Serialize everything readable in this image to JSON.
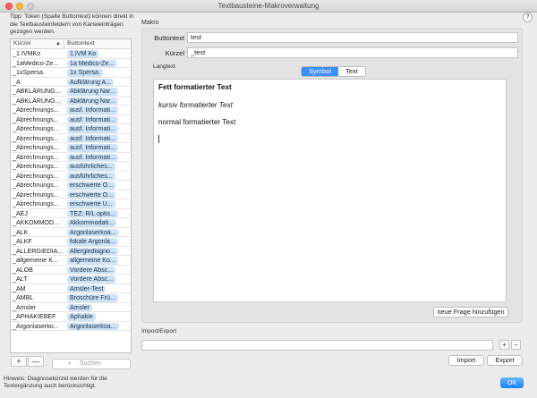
{
  "window": {
    "title": "Textbausteine-Makroverwaltung"
  },
  "tip": "Tipp: Token (Spalte Buttontext) können direkt in die Textbausteinfeldern von Karteieinträgen gezogen werden.",
  "list": {
    "col_kuerzel": "Kürzel",
    "col_buttontext": "Buttontext",
    "sort_indicator": "▲",
    "rows": [
      {
        "k": "_1.IVMKo",
        "b": "1.IVM Ko"
      },
      {
        "k": "_1aMedico-Ze...",
        "b": "1a Medico-Ze..."
      },
      {
        "k": "_1xSpersa.",
        "b": "1x Spersa."
      },
      {
        "k": "_A",
        "b": "Aufklärung A..."
      },
      {
        "k": "_ABKLÄRUNG...",
        "b": "Abklärung Nar..."
      },
      {
        "k": "_ABKLÄRUNG...",
        "b": "Abklärung Nar..."
      },
      {
        "k": "_Abrechnungs...",
        "b": "ausf. Informati..."
      },
      {
        "k": "_Abrechnungs...",
        "b": "ausf. Informati..."
      },
      {
        "k": "_Abrechnungs...",
        "b": "ausf. Informati..."
      },
      {
        "k": "_Abrechnungs...",
        "b": "ausf. Informati..."
      },
      {
        "k": "_Abrechnungs...",
        "b": "ausf. Informati..."
      },
      {
        "k": "_Abrechnungs...",
        "b": "ausf. Informati..."
      },
      {
        "k": "_Abrechnungs...",
        "b": "ausführliches..."
      },
      {
        "k": "_Abrechnungs...",
        "b": "ausführliches..."
      },
      {
        "k": "_Abrechnungs...",
        "b": "erschwerte O..."
      },
      {
        "k": "_Abrechnungs...",
        "b": "erschwerte O..."
      },
      {
        "k": "_Abrechnungs...",
        "b": "erschwerte U..."
      },
      {
        "k": "_AEJ",
        "b": "TEZ: R/L optis..."
      },
      {
        "k": "_AKKOMMOD...",
        "b": "Akkommodati..."
      },
      {
        "k": "_ALK",
        "b": "Argonlaserkoa..."
      },
      {
        "k": "_ALKF",
        "b": "fokale Argonla..."
      },
      {
        "k": "_ALLERGIEDIA...",
        "b": "Allergiediagno..."
      },
      {
        "k": "_allgemeine K...",
        "b": "allgemeine Ko..."
      },
      {
        "k": "_ALOB",
        "b": "Vordere Absc..."
      },
      {
        "k": "_ALT",
        "b": "Vordere Absc..."
      },
      {
        "k": "_AM",
        "b": "Amsler-Test"
      },
      {
        "k": "_AMBL",
        "b": "Broschüre Frü..."
      },
      {
        "k": "_Amsler",
        "b": "Amsler"
      },
      {
        "k": "_APHAKIEBEF",
        "b": "Aphakie"
      },
      {
        "k": "_Argonlaserko...",
        "b": "Argonlaserkoa..."
      }
    ]
  },
  "list_buttons": {
    "add": "+",
    "remove": "—"
  },
  "search": {
    "placeholder": "Suchen",
    "icon": "search-icon"
  },
  "hint": "Hinweis: Diagnosekürzel werden für die Textergänzung auch berücksichtigt.",
  "ok_label": "OK",
  "help_label": "?",
  "makro": {
    "section": "Makro",
    "buttontext_label": "Buttontext",
    "buttontext_value": "test",
    "kuerzel_label": "Kürzel",
    "kuerzel_value": "_test",
    "langtext_label": "Langtext",
    "tabs": [
      "Symbol",
      "Text"
    ],
    "active_tab": "Symbol",
    "editor": {
      "line_bold": "Fett formatierter Text",
      "line_italic": "kursiv formatierter Text",
      "line_normal": "normal formatierter Text"
    },
    "neue_frage_label": "neue Frage hinzufügen"
  },
  "import_export": {
    "section": "Import/Export",
    "add": "+",
    "remove": "−",
    "import_label": "Import",
    "export_label": "Export"
  },
  "colors": {
    "accent": "#3d8ef6",
    "pill": "#cfe3f7"
  }
}
